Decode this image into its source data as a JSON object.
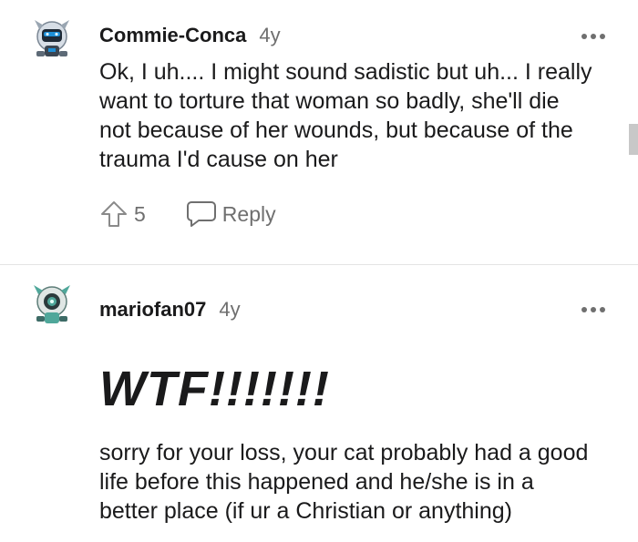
{
  "comments": [
    {
      "username": "Commie-Conca",
      "age": "4y",
      "text": "Ok, I uh.... I might sound sadistic but uh... I really want to torture that woman so badly, she'll die not because of her wounds, but because of the trauma I'd cause on her",
      "votes": "5",
      "reply_label": "Reply",
      "avatar_icon": "robot-avatar-icon"
    },
    {
      "username": "mariofan07",
      "age": "4y",
      "headline": "WTF!!!!!!!",
      "text": "sorry for your loss, your cat probably had a good life before this happened and he/she is in a better place (if ur a Christian or anything)",
      "avatar_icon": "robot-avatar-icon"
    }
  ],
  "colors": {
    "text": "#1a1a1b",
    "muted": "#6f6f6f",
    "divider": "#e4e4e4",
    "avatar_blue": "#1e8fd6",
    "avatar_teal": "#4fa79a"
  }
}
